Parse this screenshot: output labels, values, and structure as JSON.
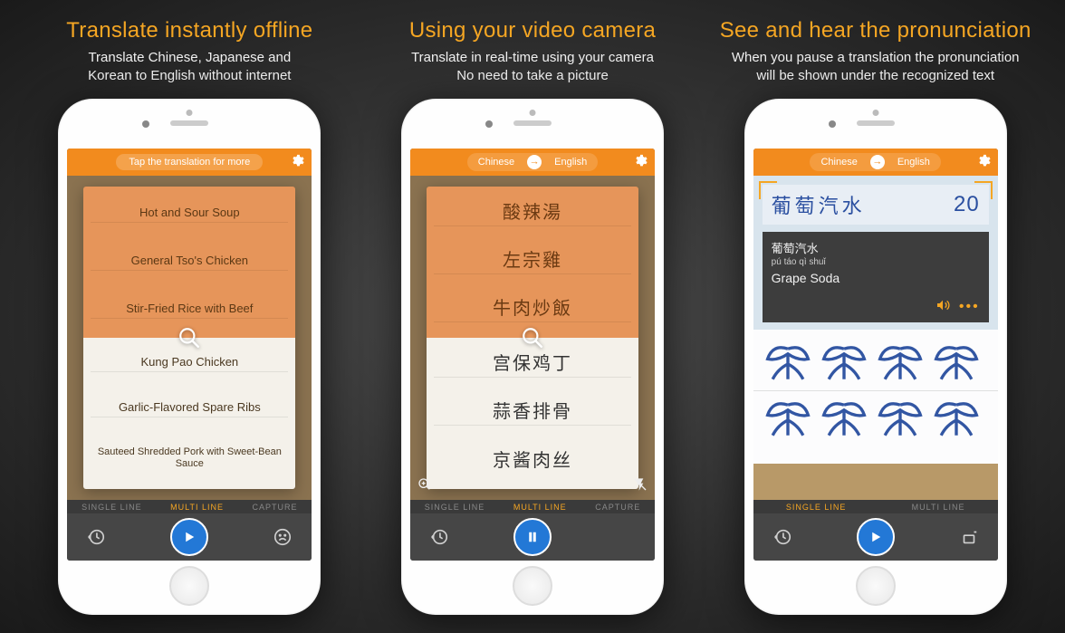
{
  "columns": [
    {
      "heading": "Translate instantly offline",
      "subheading": "Translate Chinese, Japanese and\nKorean to English without internet"
    },
    {
      "heading": "Using your video camera",
      "subheading": "Translate in real-time using your camera\nNo need to take a picture"
    },
    {
      "heading": "See and hear the pronunciation",
      "subheading": "When you pause a translation the pronunciation\nwill be shown under the recognized text"
    }
  ],
  "screen1": {
    "topbar_hint": "Tap the translation for more",
    "tabs": {
      "single": "SINGLE LINE",
      "multi": "MULTI LINE",
      "capture": "CAPTURE",
      "active": "multi"
    },
    "menu": {
      "top": [
        "Hot and Sour Soup",
        "General Tso's Chicken",
        "Stir-Fried Rice with Beef"
      ],
      "bottom": [
        "Kung Pao Chicken",
        "Garlic-Flavored Spare Ribs",
        "Sauteed Shredded Pork with Sweet-Bean Sauce"
      ]
    }
  },
  "screen2": {
    "lang_from": "Chinese",
    "lang_to": "English",
    "tabs": {
      "single": "SINGLE LINE",
      "multi": "MULTI LINE",
      "capture": "CAPTURE",
      "active": "multi"
    },
    "menu": {
      "top": [
        "酸辣湯",
        "左宗雞",
        "牛肉炒飯"
      ],
      "bottom": [
        "宫保鸡丁",
        "蒜香排骨",
        "京酱肉丝"
      ]
    }
  },
  "screen3": {
    "lang_from": "Chinese",
    "lang_to": "English",
    "tabs": {
      "single": "SINGLE LINE",
      "multi": "MULTI LINE",
      "active": "single"
    },
    "sign_text": "葡萄汽水",
    "sign_price": "20",
    "result": {
      "cjk": "葡萄汽水",
      "pinyin": "pú táo qì shuǐ",
      "english": "Grape Soda"
    }
  }
}
